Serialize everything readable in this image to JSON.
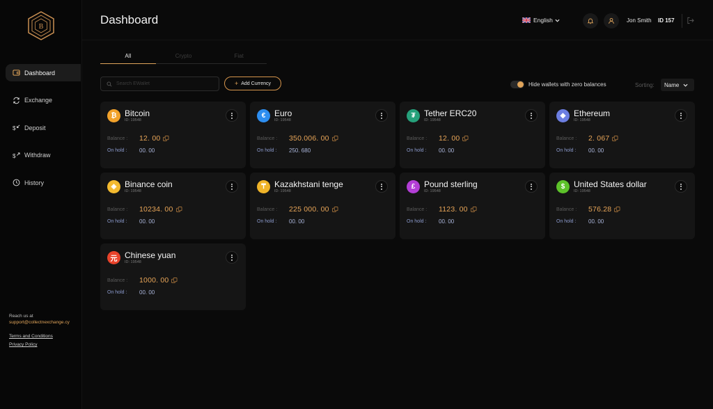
{
  "sidebar": {
    "logo_letter": "B",
    "items": [
      {
        "label": "Dashboard",
        "icon": "wallet-icon",
        "active": true
      },
      {
        "label": "Exchange",
        "icon": "exchange-icon",
        "active": false
      },
      {
        "label": "Deposit",
        "icon": "deposit-icon",
        "active": false
      },
      {
        "label": "Withdraw",
        "icon": "withdraw-icon",
        "active": false
      },
      {
        "label": "History",
        "icon": "clock-icon",
        "active": false
      }
    ],
    "footer": {
      "reach_label": "Reach us at",
      "email": "support@collectnexchange.cy",
      "terms": "Terms and Conditions",
      "privacy": "Privacy Policy"
    }
  },
  "header": {
    "title": "Dashboard",
    "language": "English",
    "user_name": "Jon Smith",
    "user_id": "ID 157"
  },
  "tabs": [
    {
      "label": "All",
      "active": true
    },
    {
      "label": "Crypto",
      "active": false
    },
    {
      "label": "Fiat",
      "active": false
    }
  ],
  "toolbar": {
    "search_placeholder": "Search EWallet",
    "add_button": "Add Currency",
    "hide_zero_label": "Hide wallets with zero balances",
    "hide_zero_enabled": true,
    "sorting_label": "Sorting:",
    "sorting_value": "Name"
  },
  "labels": {
    "balance": "Balance :",
    "on_hold": "On hold :"
  },
  "wallets": [
    {
      "name": "Bitcoin",
      "id": "ID: 19548",
      "balance": "12. 00",
      "on_hold": "00. 00",
      "icon": "bitcoin-icon",
      "glyph": "₿",
      "color": "#f2a22b"
    },
    {
      "name": "Euro",
      "id": "ID: 19548",
      "balance": "350.006. 00",
      "on_hold": "250. 680",
      "icon": "euro-icon",
      "glyph": "€",
      "color": "#2d8ef0"
    },
    {
      "name": "Tether ERC20",
      "id": "ID: 19548",
      "balance": "12. 00",
      "on_hold": "00. 00",
      "icon": "tether-icon",
      "glyph": "₮",
      "color": "#26a17b"
    },
    {
      "name": "Ethereum",
      "id": "ID: 19548",
      "balance": "2. 067",
      "on_hold": "00. 00",
      "icon": "ethereum-icon",
      "glyph": "◆",
      "color": "#6c7ee1"
    },
    {
      "name": "Binance coin",
      "id": "ID: 19548",
      "balance": "10234. 00",
      "on_hold": "00. 00",
      "icon": "binance-icon",
      "glyph": "◈",
      "color": "#f3ba2f"
    },
    {
      "name": "Kazakhstani tenge",
      "id": "ID: 19548",
      "balance": "225 000. 00",
      "on_hold": "00. 00",
      "icon": "tenge-icon",
      "glyph": "₸",
      "color": "#f0b429"
    },
    {
      "name": "Pound sterling",
      "id": "ID: 19548",
      "balance": "1123. 00",
      "on_hold": "00. 00",
      "icon": "pound-icon",
      "glyph": "£",
      "color": "#b33ed6"
    },
    {
      "name": "United States dollar",
      "id": "ID: 19548",
      "balance": "576.28",
      "on_hold": "00. 00",
      "icon": "dollar-icon",
      "glyph": "$",
      "color": "#5dc22a"
    },
    {
      "name": "Chinese yuan",
      "id": "ID: 19548",
      "balance": "1000. 00",
      "on_hold": "00. 00",
      "icon": "yuan-icon",
      "glyph": "元",
      "color": "#e8432b"
    }
  ],
  "colors": {
    "accent": "#e0a45a",
    "background": "#0a0a0a",
    "card": "#151515",
    "on_hold": "#8d9ccf"
  }
}
